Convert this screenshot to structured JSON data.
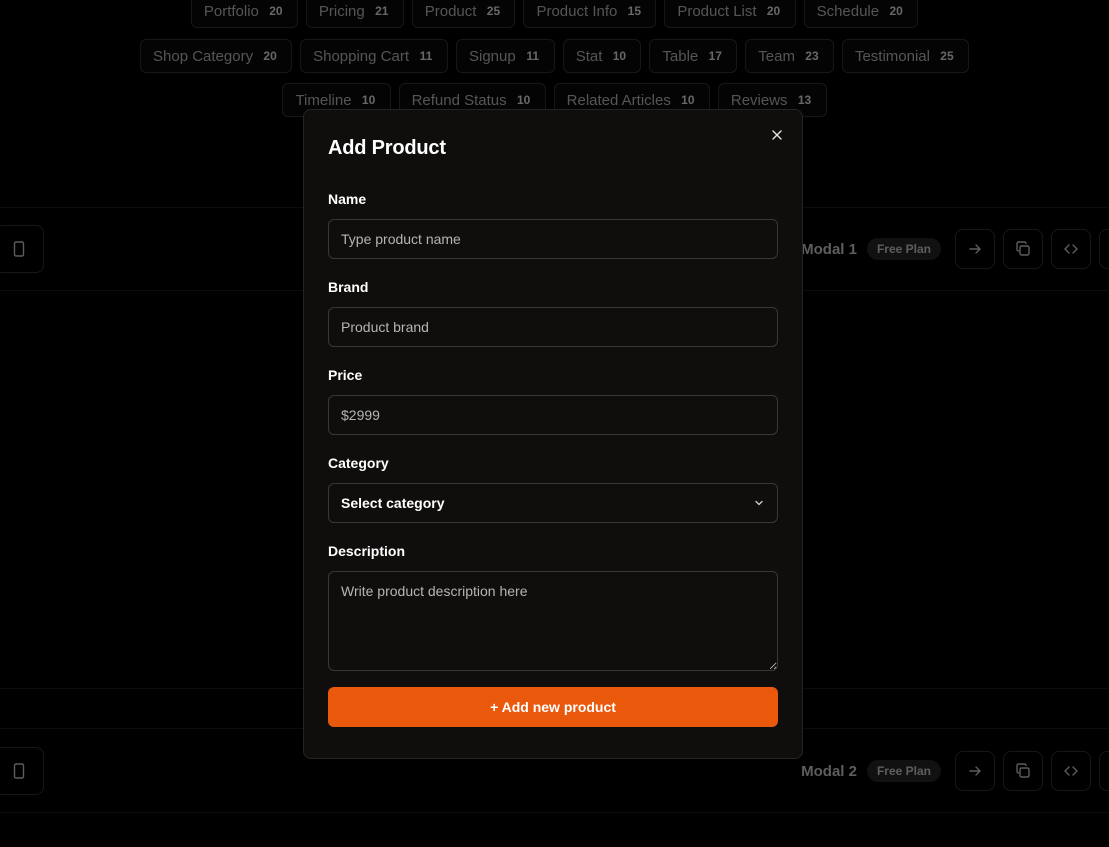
{
  "background": {
    "chip_rows": [
      [
        {
          "label": "Portfolio",
          "count": "20"
        },
        {
          "label": "Pricing",
          "count": "21"
        },
        {
          "label": "Product",
          "count": "25"
        },
        {
          "label": "Product Info",
          "count": "15"
        },
        {
          "label": "Product List",
          "count": "20"
        },
        {
          "label": "Schedule",
          "count": "20"
        }
      ],
      [
        {
          "label": "Shop Category",
          "count": "20"
        },
        {
          "label": "Shopping Cart",
          "count": "11"
        },
        {
          "label": "Signup",
          "count": "11"
        },
        {
          "label": "Stat",
          "count": "10"
        },
        {
          "label": "Table",
          "count": "17"
        },
        {
          "label": "Team",
          "count": "23"
        },
        {
          "label": "Testimonial",
          "count": "25"
        }
      ],
      [
        {
          "label": "Timeline",
          "count": "10"
        },
        {
          "label": "Refund Status",
          "count": "10"
        },
        {
          "label": "Related Articles",
          "count": "10"
        },
        {
          "label": "Reviews",
          "count": "13"
        }
      ]
    ],
    "toolbars": [
      {
        "name": "Modal 1",
        "plan": "Free Plan"
      },
      {
        "name": "Modal 2",
        "plan": "Free Plan"
      }
    ],
    "toolbar_icons": [
      "arrow-right-icon",
      "copy-icon",
      "code-icon"
    ]
  },
  "modal": {
    "title": "Add Product",
    "close_icon": "close-icon",
    "fields": {
      "name": {
        "label": "Name",
        "placeholder": "Type product name"
      },
      "brand": {
        "label": "Brand",
        "placeholder": "Product brand"
      },
      "price": {
        "label": "Price",
        "placeholder": "$2999"
      },
      "category": {
        "label": "Category",
        "selected": "Select category",
        "icon": "chevron-down-icon"
      },
      "description": {
        "label": "Description",
        "placeholder": "Write product description here"
      }
    },
    "submit_label": "+ Add new product"
  },
  "colors": {
    "accent": "#ea580c",
    "modal_bg": "#0f0e0d",
    "border": "#3a3734"
  }
}
